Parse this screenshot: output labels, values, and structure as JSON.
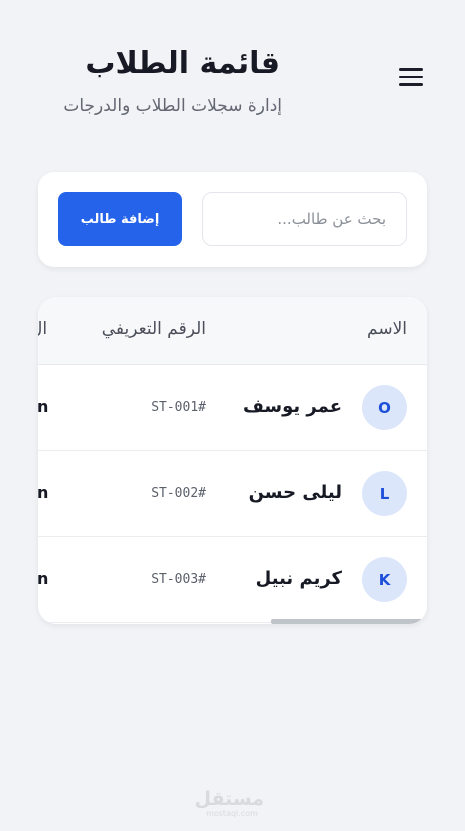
{
  "header": {
    "title": "قائمة الطلاب",
    "subtitle": "إدارة سجلات الطلاب والدرجات"
  },
  "toolbar": {
    "search_placeholder": "بحث عن طالب...",
    "add_label": "إضافة طالب"
  },
  "table": {
    "columns": [
      "الاسم",
      "الرقم التعريفي",
      "ال"
    ],
    "rows": [
      {
        "initial": "O",
        "name": "عمر يوسف",
        "id": "#ST-001",
        "grade": "n"
      },
      {
        "initial": "L",
        "name": "ليلى حسن",
        "id": "#ST-002",
        "grade": "n"
      },
      {
        "initial": "K",
        "name": "كريم نبيل",
        "id": "#ST-003",
        "grade": "n"
      }
    ]
  },
  "watermark": {
    "logo": "مستقل",
    "url": "mostaql.com"
  },
  "icons": {
    "menu": "hamburger-menu-icon"
  },
  "colors": {
    "accent": "#2563eb",
    "avatar_bg": "#dce6fb",
    "avatar_text": "#1d4fd8",
    "background": "#f2f3f6"
  }
}
